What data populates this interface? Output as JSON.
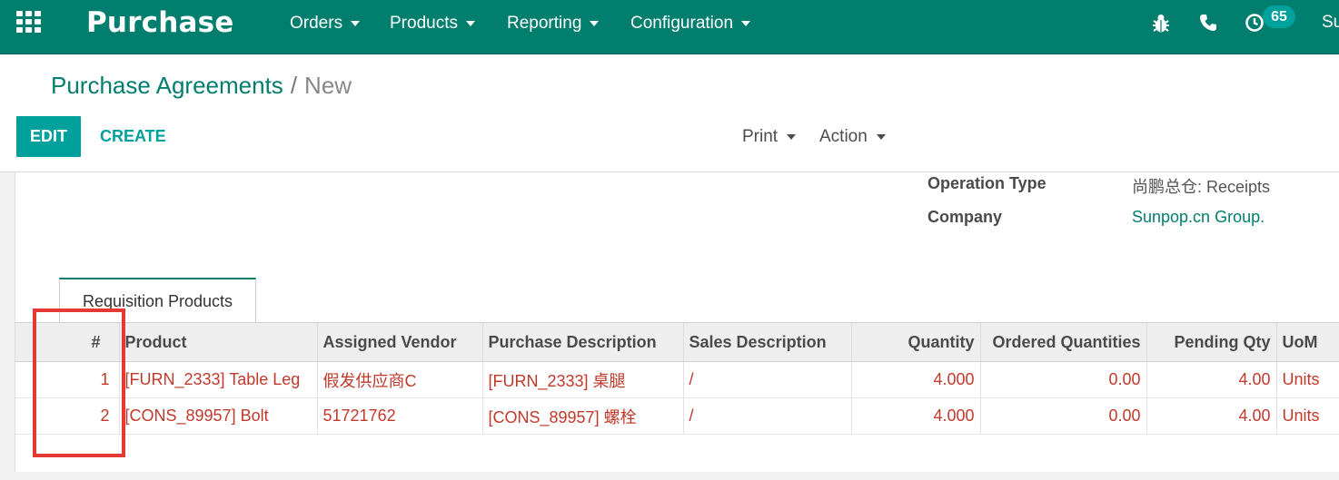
{
  "navbar": {
    "app_name": "Purchase",
    "menus": [
      "Orders",
      "Products",
      "Reporting",
      "Configuration"
    ],
    "activity_count": "65",
    "user_truncated": "Su",
    "icons": [
      "apps-grid-icon",
      "bug-icon",
      "phone-icon",
      "activity-clock-icon"
    ]
  },
  "breadcrumb": {
    "parent": "Purchase Agreements",
    "separator": "/",
    "current": "New"
  },
  "toolbar": {
    "edit_label": "EDIT",
    "create_label": "CREATE",
    "print_label": "Print",
    "action_label": "Action"
  },
  "fields": {
    "operation_type_label": "Operation Type",
    "operation_type_value": "尚鹏总仓: Receipts",
    "company_label": "Company",
    "company_value": "Sunpop.cn Group."
  },
  "tab": {
    "label": "Requisition Products"
  },
  "table": {
    "columns": [
      "#",
      "Product",
      "Assigned Vendor",
      "Purchase Description",
      "Sales Description",
      "Quantity",
      "Ordered Quantities",
      "Pending Qty",
      "UoM"
    ],
    "rows": [
      {
        "seq": "1",
        "product": "[FURN_2333] Table Leg",
        "vendor": "假发供应商C",
        "purchase_desc": "[FURN_2333] 桌腿",
        "sales_desc": "/",
        "quantity": "4.000",
        "ordered": "0.00",
        "pending": "4.00",
        "uom": "Units"
      },
      {
        "seq": "2",
        "product": "[CONS_89957] Bolt",
        "vendor": "51721762",
        "purchase_desc": "[CONS_89957] 螺栓",
        "sales_desc": "/",
        "quantity": "4.000",
        "ordered": "0.00",
        "pending": "4.00",
        "uom": "Units"
      }
    ]
  },
  "colors": {
    "navbar": "#017e6e",
    "primary_button": "#00a09d",
    "row_text": "#c0392b",
    "highlight_box": "#e53935"
  }
}
